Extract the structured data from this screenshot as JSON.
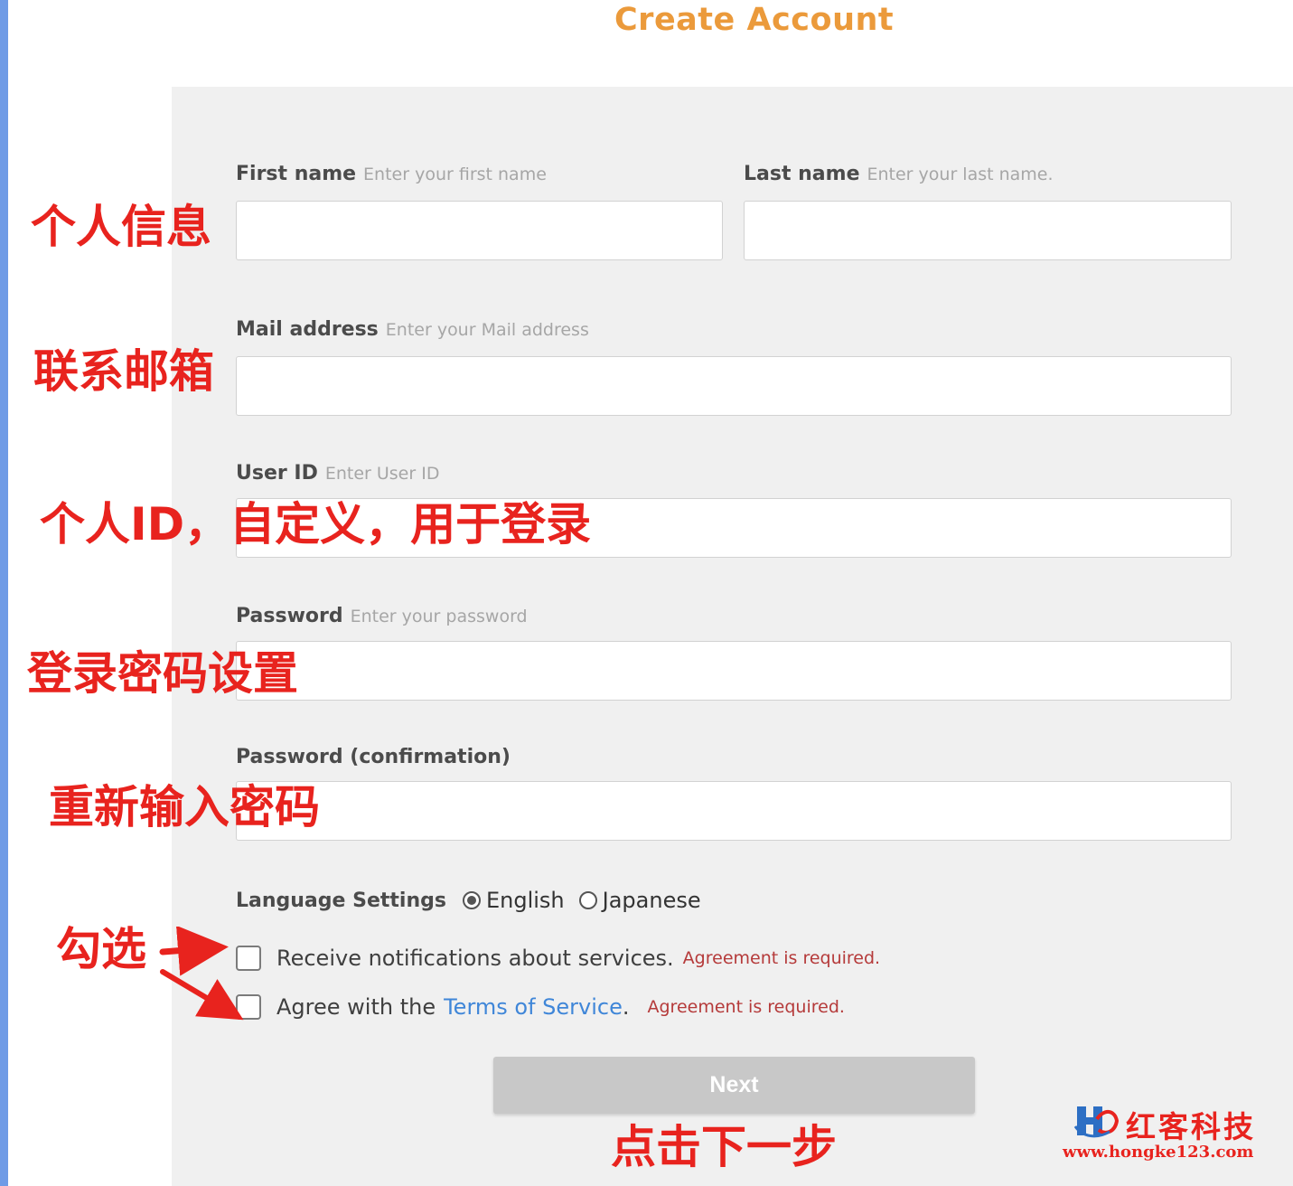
{
  "page": {
    "title": "Create Account"
  },
  "form": {
    "first_name": {
      "label": "First name",
      "hint": "Enter your first name",
      "value": ""
    },
    "last_name": {
      "label": "Last name",
      "hint": "Enter your last name.",
      "value": ""
    },
    "mail": {
      "label": "Mail address",
      "hint": "Enter your Mail address",
      "value": ""
    },
    "user_id": {
      "label": "User ID",
      "hint": "Enter User ID",
      "value": ""
    },
    "password": {
      "label": "Password",
      "hint": "Enter your password",
      "value": ""
    },
    "password_confirm": {
      "label": "Password (confirmation)",
      "value": ""
    },
    "language": {
      "label": "Language Settings",
      "options": [
        "English",
        "Japanese"
      ],
      "selected": "English"
    },
    "notifications": {
      "text": "Receive notifications about services.",
      "required_note": "Agreement is required.",
      "checked": false
    },
    "terms": {
      "text_before": "Agree with the",
      "link_text": "Terms of Service",
      "text_after": ".",
      "required_note": "Agreement is required.",
      "checked": false
    },
    "next_label": "Next"
  },
  "annotations": {
    "personal_info": "个人信息",
    "contact_mail": "联系邮箱",
    "user_id_prefix": "个人ID，",
    "user_id_rest": "自定义，用于登录",
    "password": "登录密码设置",
    "password_confirm": "重新输入密码",
    "check": "勾选",
    "click_next": "点击下一步"
  },
  "watermark": {
    "name": "红客科技",
    "url": "www.hongke123.com"
  },
  "colors": {
    "title": "#eb9a3b",
    "annotation": "#e8231e",
    "link": "#3f86d8",
    "required": "#b53a3a",
    "panel": "#f0f0f0",
    "button": "#c8c8c8"
  }
}
